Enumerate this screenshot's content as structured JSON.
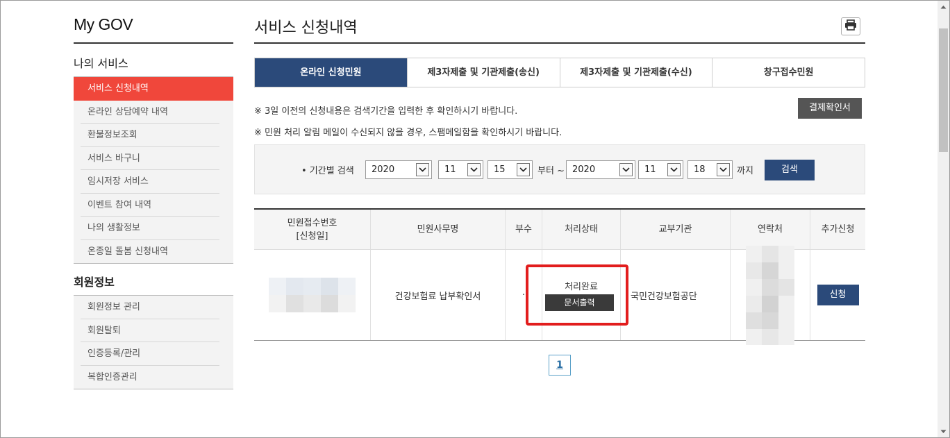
{
  "sidebar": {
    "brand": "My GOV",
    "section1_title": "나의 서비스",
    "section1_items": [
      {
        "label": "서비스 신청내역"
      },
      {
        "label": "온라인 상담예약 내역"
      },
      {
        "label": "환불정보조회"
      },
      {
        "label": "서비스 바구니"
      },
      {
        "label": "임시저장 서비스"
      },
      {
        "label": "이벤트 참여 내역"
      },
      {
        "label": "나의 생활정보"
      },
      {
        "label": "온종일 돌봄 신청내역"
      }
    ],
    "section2_title": "회원정보",
    "section2_items": [
      {
        "label": "회원정보 관리"
      },
      {
        "label": "회원탈퇴"
      },
      {
        "label": "인증등록/관리"
      },
      {
        "label": "복합인증관리"
      }
    ]
  },
  "main": {
    "title": "서비스 신청내역",
    "tabs": [
      {
        "label": "온라인 신청민원"
      },
      {
        "label": "제3자제출 및 기관제출(송신)"
      },
      {
        "label": "제3자제출 및 기관제출(수신)"
      },
      {
        "label": "창구접수민원"
      }
    ],
    "notice1": "※ 3일 이전의 신청내용은 검색기간을 입력한 후 확인하시기 바랍니다.",
    "notice2": "※ 민원 처리 알림 메일이 수신되지 않을 경우, 스팸메일함을 확인하시기 바랍니다.",
    "receipt_button": "결제확인서",
    "search": {
      "label": "• 기간별 검색",
      "from_year": "2020",
      "from_month": "11",
      "from_day": "15",
      "from_text": "부터 ~",
      "to_year": "2020",
      "to_month": "11",
      "to_day": "18",
      "to_text": "까지",
      "button": "검색"
    },
    "table": {
      "headers": [
        "민원접수번호",
        "[신청일]",
        "민원사무명",
        "부수",
        "처리상태",
        "교부기관",
        "연락처",
        "추가신청"
      ],
      "row": {
        "service_name": "건강보험료 납부확인서",
        "copies": "·",
        "status": "처리완료",
        "print_button": "문서출력",
        "agency": "국민건강보험공단",
        "apply_button": "신청"
      }
    },
    "pagination": {
      "current": "1"
    }
  },
  "colors": {
    "accent_red": "#f0473b",
    "navy": "#2b4a7a",
    "highlight": "#e21d1d"
  }
}
